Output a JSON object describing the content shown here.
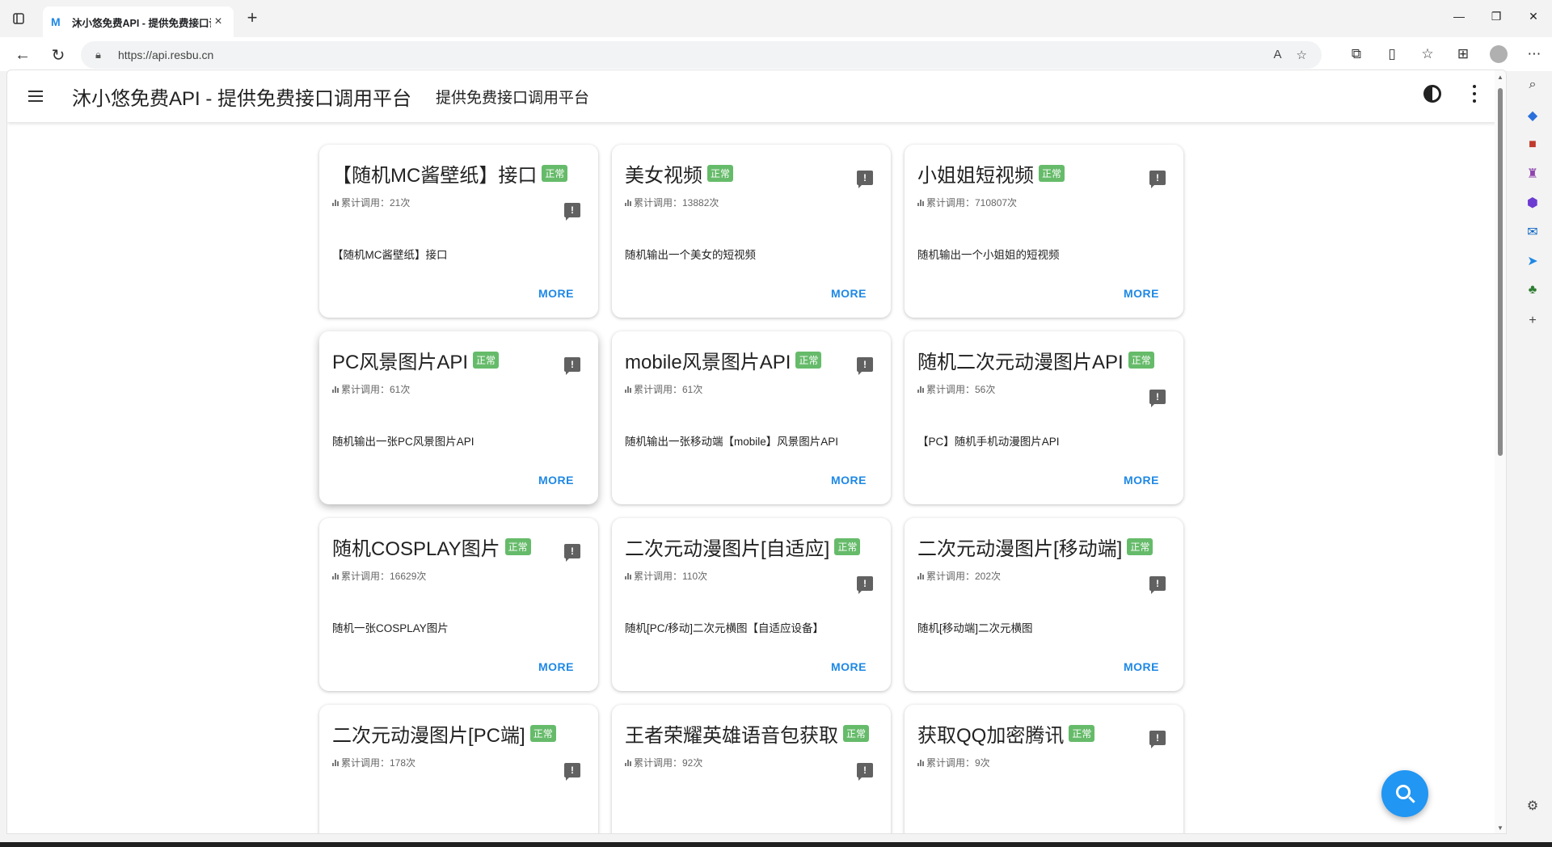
{
  "browser": {
    "tab_title": "沐小悠免费API - 提供免费接口调",
    "tab_favicon": "M",
    "url": "https://api.resbu.cn"
  },
  "app": {
    "title": "沐小悠免费API - 提供免费接口调用平台",
    "subtitle": "提供免费接口调用平台"
  },
  "cards": [
    {
      "title": "【随机MC酱壁纸】接口",
      "status": "正常",
      "count_label": "累计调用：21次",
      "desc": "【随机MC酱壁纸】接口",
      "more": "MORE",
      "icon_low": true
    },
    {
      "title": "美女视频",
      "status": "正常",
      "count_label": "累计调用：13882次",
      "desc": "随机输出一个美女的短视频",
      "more": "MORE",
      "icon_low": false
    },
    {
      "title": "小姐姐短视频",
      "status": "正常",
      "count_label": "累计调用：710807次",
      "desc": "随机输出一个小姐姐的短视频",
      "more": "MORE",
      "icon_low": false
    },
    {
      "title": "PC风景图片API",
      "status": "正常",
      "count_label": "累计调用：61次",
      "desc": "随机输出一张PC风景图片API",
      "more": "MORE",
      "icon_low": false
    },
    {
      "title": "mobile风景图片API",
      "status": "正常",
      "count_label": "累计调用：61次",
      "desc": "随机输出一张移动端【mobile】风景图片API",
      "more": "MORE",
      "icon_low": false
    },
    {
      "title": "随机二次元动漫图片API",
      "status": "正常",
      "count_label": "累计调用：56次",
      "desc": "【PC】随机手机动漫图片API",
      "more": "MORE",
      "icon_low": true
    },
    {
      "title": "随机COSPLAY图片",
      "status": "正常",
      "count_label": "累计调用：16629次",
      "desc": "随机一张COSPLAY图片",
      "more": "MORE",
      "icon_low": false
    },
    {
      "title": "二次元动漫图片[自适应]",
      "status": "正常",
      "count_label": "累计调用：110次",
      "desc": "随机[PC/移动]二次元横图【自适应设备】",
      "more": "MORE",
      "icon_low": true
    },
    {
      "title": "二次元动漫图片[移动端]",
      "status": "正常",
      "count_label": "累计调用：202次",
      "desc": "随机[移动端]二次元横图",
      "more": "MORE",
      "icon_low": true
    },
    {
      "title": "二次元动漫图片[PC端]",
      "status": "正常",
      "count_label": "累计调用：178次",
      "desc": "",
      "more": "",
      "icon_low": true
    },
    {
      "title": "王者荣耀英雄语音包获取",
      "status": "正常",
      "count_label": "累计调用：92次",
      "desc": "",
      "more": "",
      "icon_low": true
    },
    {
      "title": "获取QQ加密腾讯",
      "status": "正常",
      "count_label": "累计调用：9次",
      "desc": "",
      "more": "",
      "icon_low": false
    }
  ],
  "colors": {
    "badge": "#66bb6a",
    "accent": "#1e88e5",
    "fab": "#2196f3"
  }
}
